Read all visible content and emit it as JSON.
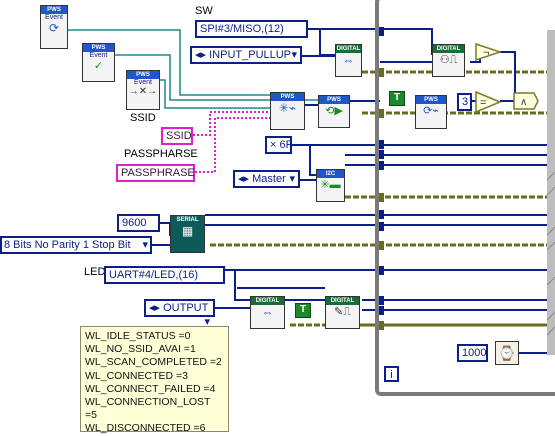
{
  "labels": {
    "sw": "SW",
    "ssid": "SSID",
    "passpharse": "PASSPHARSE",
    "led": "LED"
  },
  "controls": {
    "sw_pin": "SPI#3/MISO,(12)",
    "input_mode": "INPUT_PULLUP",
    "ssid_value": "SSID",
    "passphrase_value": "PASSPHRASE",
    "i2c_addr": "× 6F",
    "i2c_mode": "Master",
    "baud": "9600",
    "serial_format": "8 Bits No Parity 1 Stop Bit",
    "led_pin": "UART#4/LED,(16)",
    "output_mode": "OUTPUT",
    "const_3": "3",
    "delay": "1000",
    "const_true_1": "T",
    "const_true_2": "T",
    "info": "i"
  },
  "blocks": {
    "pws": "PWS",
    "event": "Event",
    "digital": "DIGITAL",
    "i2c": "I2C",
    "serial": "SERIAL"
  },
  "status_lines": [
    "WL_IDLE_STATUS =0",
    "WL_NO_SSID_AVAI =1",
    "WL_SCAN_COMPLETED =2",
    "WL_CONNECTED =3",
    "WL_CONNECT_FAILED =4",
    "WL_CONNECTION_LOST =5",
    "WL_DISCONNECTED =6"
  ],
  "colors": {
    "wire_blue": "#0b1f8a",
    "wire_gold": "#6b6b1f",
    "pink": "#e020d0",
    "green": "#1b8a2a",
    "struct_gray": "#7a7a7a",
    "note_bg": "#ffffd8"
  }
}
